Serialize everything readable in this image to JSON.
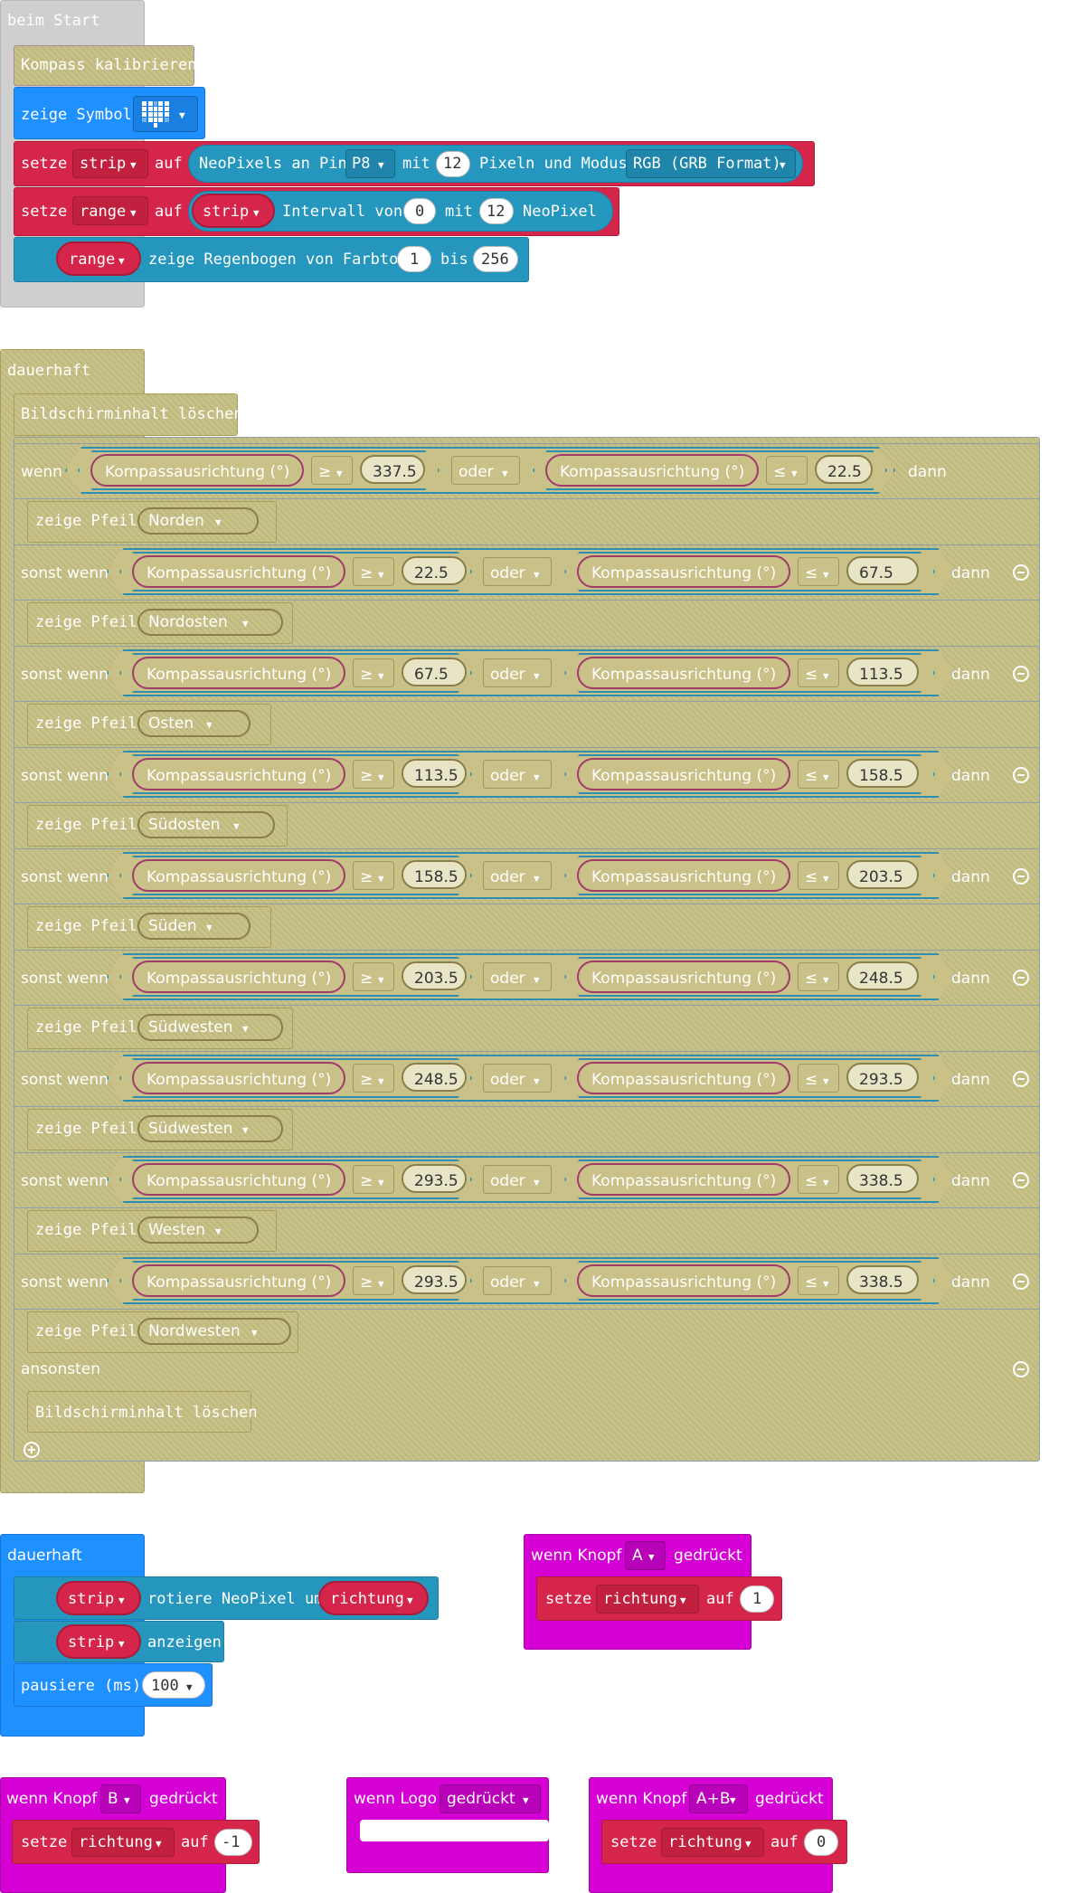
{
  "start_block": {
    "title": "beim Start",
    "calibrate": "Kompass kalibrieren",
    "show_icon": "zeige Symbol",
    "icon_name": "heart-icon",
    "set1": {
      "setze": "setze",
      "var": "strip",
      "auf": "auf",
      "neo": "NeoPixels an Pin",
      "pin": "P8",
      "mit": "mit",
      "count": "12",
      "pixels_mode": "Pixeln und Modus",
      "mode": "RGB (GRB Format)"
    },
    "set2": {
      "setze": "setze",
      "var": "range",
      "auf": "auf",
      "strip": "strip",
      "interval": "Intervall von",
      "from": "0",
      "mit": "mit",
      "count": "12",
      "neo": "NeoPixel"
    },
    "rainbow": {
      "var": "range",
      "text": "zeige Regenbogen von Farbton",
      "from": "1",
      "bis": "bis",
      "to": "256"
    }
  },
  "forever_block": {
    "title": "dauerhaft",
    "clear": "Bildschirminhalt löschen",
    "if_label": "wenn",
    "elseif_label": "sonst wenn",
    "then_label": "dann",
    "reporter": "Kompassausrichtung (°)",
    "ge": "≥",
    "le": "≤",
    "or": "oder",
    "show_arrow": "zeige Pfeil",
    "branches": [
      {
        "lo": "337.5",
        "hi": "22.5",
        "dir": "Norden"
      },
      {
        "lo": "22.5",
        "hi": "67.5",
        "dir": "Nordosten"
      },
      {
        "lo": "67.5",
        "hi": "113.5",
        "dir": "Osten"
      },
      {
        "lo": "113.5",
        "hi": "158.5",
        "dir": "Südosten"
      },
      {
        "lo": "158.5",
        "hi": "203.5",
        "dir": "Süden"
      },
      {
        "lo": "203.5",
        "hi": "248.5",
        "dir": "Südwesten"
      },
      {
        "lo": "248.5",
        "hi": "293.5",
        "dir": "Südwesten"
      },
      {
        "lo": "293.5",
        "hi": "338.5",
        "dir": "Westen"
      },
      {
        "lo": "293.5",
        "hi": "338.5",
        "dir": "Nordwesten"
      }
    ],
    "else_label": "ansonsten",
    "else_clear": "Bildschirminhalt löschen"
  },
  "forever2": {
    "title": "dauerhaft",
    "strip": "strip",
    "rotate": "rotiere NeoPixel um",
    "richtung": "richtung",
    "show": "anzeigen",
    "pause": "pausiere (ms)",
    "ms": "100"
  },
  "button_a": {
    "wenn": "wenn Knopf",
    "key": "A",
    "pressed": "gedrückt",
    "setze": "setze",
    "var": "richtung",
    "auf": "auf",
    "val": "1"
  },
  "button_b": {
    "wenn": "wenn Knopf",
    "key": "B",
    "pressed": "gedrückt",
    "setze": "setze",
    "var": "richtung",
    "auf": "auf",
    "val": "-1"
  },
  "logo": {
    "wenn": "wenn Logo",
    "pressed": "gedrückt"
  },
  "button_ab": {
    "wenn": "wenn Knopf",
    "key": "A+B",
    "pressed": "gedrückt",
    "setze": "setze",
    "var": "richtung",
    "auf": "auf",
    "val": "0"
  },
  "colors": {
    "gray": "#cfcfcf",
    "khaki": "#c9c187",
    "blue": "#1e90ff",
    "red": "#d6254a",
    "teal": "#2596be",
    "magenta": "#d400d4"
  }
}
